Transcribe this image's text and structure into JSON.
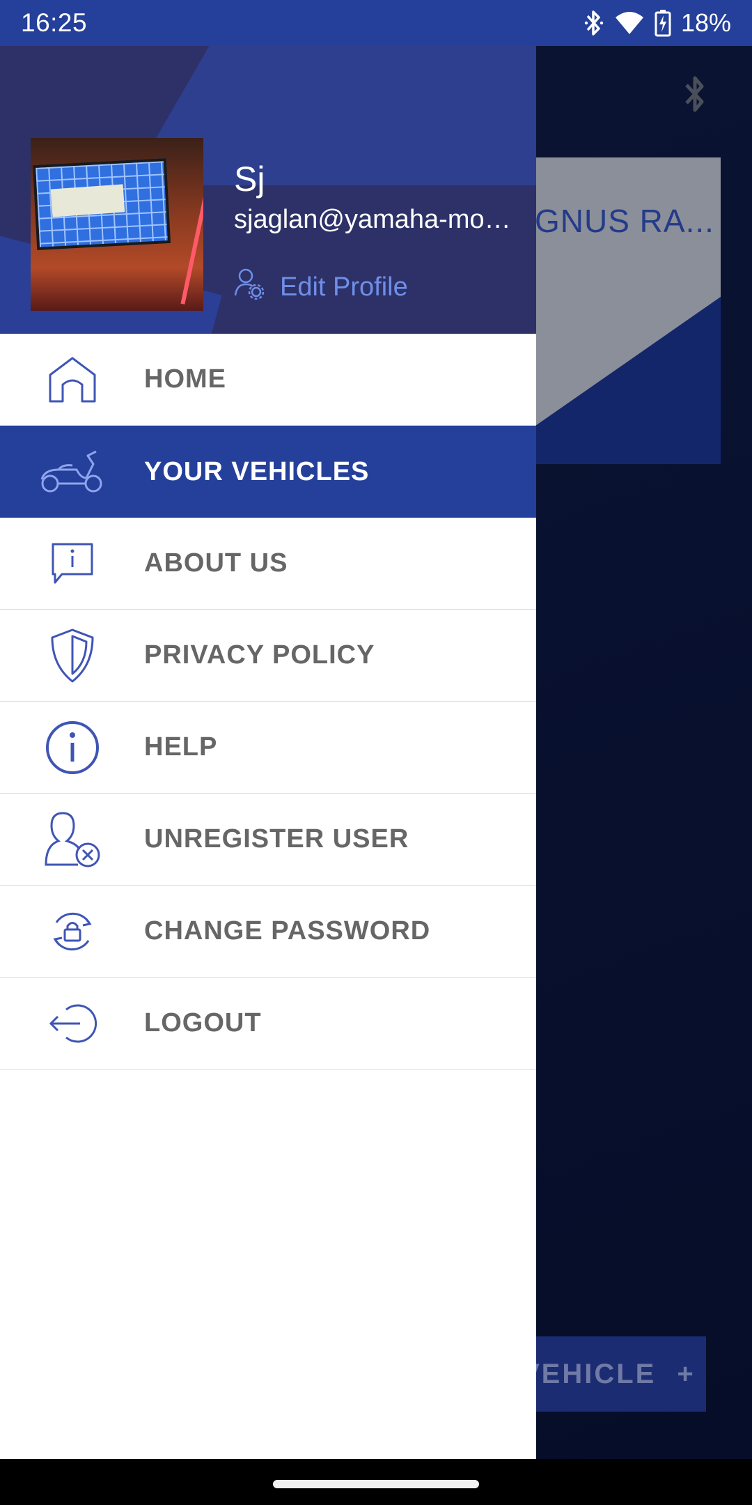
{
  "status_bar": {
    "time": "16:25",
    "battery": "18%",
    "icons": [
      "bluetooth-icon",
      "wifi-icon",
      "battery-charging-icon"
    ]
  },
  "background": {
    "card_title": "GNUS RA...",
    "add_button_label": "VEHICLE",
    "add_button_icon": "+"
  },
  "drawer": {
    "user": {
      "name": "Sj",
      "email": "sjaglan@yamaha-motor-india.com",
      "edit_profile_label": "Edit Profile"
    },
    "menu": [
      {
        "label": "HOME",
        "icon": "home-icon",
        "active": false
      },
      {
        "label": "YOUR VEHICLES",
        "icon": "scooter-icon",
        "active": true
      },
      {
        "label": "ABOUT US",
        "icon": "info-bubble-icon",
        "active": false
      },
      {
        "label": "PRIVACY POLICY",
        "icon": "shield-icon",
        "active": false
      },
      {
        "label": "HELP",
        "icon": "info-circle-icon",
        "active": false
      },
      {
        "label": "UNREGISTER USER",
        "icon": "user-remove-icon",
        "active": false
      },
      {
        "label": "CHANGE PASSWORD",
        "icon": "lock-refresh-icon",
        "active": false
      },
      {
        "label": "LOGOUT",
        "icon": "logout-icon",
        "active": false
      }
    ]
  },
  "colors": {
    "status_bar": "#24409a",
    "header_bg": "#2d3168",
    "active_item_bg": "#25409b",
    "icon_blue": "#3f55b5",
    "label_gray": "#666666",
    "link_blue": "#6f8fe8"
  }
}
